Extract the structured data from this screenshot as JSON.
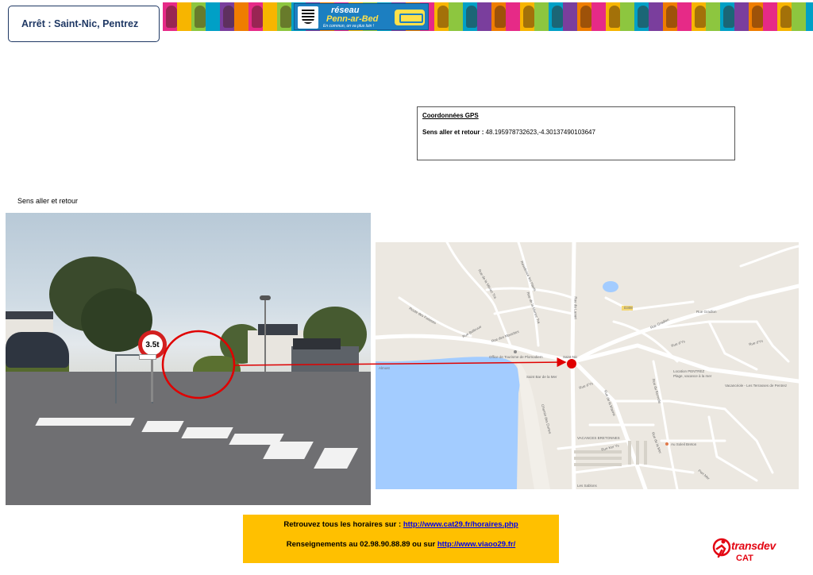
{
  "title": "Arrêt : Saint-Nic, Pentrez",
  "banner": {
    "logo_line1": "réseau",
    "logo_line2": "Penn-ar-Bed",
    "logo_tagline": "En commun, on va plus loin !"
  },
  "gps": {
    "heading": "Coordonnées GPS",
    "label": "Sens aller et retour :",
    "value": "48.195978732623,-4.30137490103647"
  },
  "photo": {
    "caption": "Sens aller et retour",
    "sign_text": "3.5t"
  },
  "map": {
    "labels": {
      "rue_lehou": "Rue de la Ménez Tra",
      "residence": "Résidence les Hauts",
      "rue_laoury": "Rue du Laouri",
      "route_falaises": "Route des Falaises",
      "rue_bellevue": "Rue Bellevue",
      "rue_mouettes": "Rue des Mouettes",
      "rue_menez": "Rue de la Menez Tra",
      "rue_gradlon": "Rue Gradlon",
      "d308": "D308",
      "rue_gradlon2": "Rue Gradlon",
      "rue_dys": "Rue d'Ys",
      "rue_dys2": "Rue d'Ys",
      "office": "Office de Tourisme de Plomodiern",
      "saint_bar": "Saint Bar de la Mer",
      "rue_dys3": "Rue d'Ys",
      "location": "Location PENTREZ",
      "plage": "Plage, vacance à la mer",
      "vacances_lili": "Vacancéole - Les Terrasses de Pentrez",
      "chemin_dunes": "Chemin des Dunes",
      "vacances_bretonnes": "VACANCES BRETONNES",
      "au_soleil": "Au Soleil Breton",
      "rue_kervelle": "Rue du Kervelle",
      "rue_kerys": "Rue Ker Ys",
      "rue_mer": "Rue de la Mer",
      "rue_marine": "Rue de la Marine",
      "port_mer": "Port Mer",
      "les_sablons": "Les Sablons",
      "almost": "Almost",
      "saint_nic_stop": "Saint-Nic"
    },
    "colors": {
      "land": "#ece8e1",
      "road": "#ffffff",
      "water": "#a3ccff",
      "beach": "#f2efe9",
      "marker": "#e00000"
    }
  },
  "info": {
    "line1_prefix": "Retrouvez tous les horaires sur : ",
    "line1_link": "http://www.cat29.fr/horaires.php",
    "line2_prefix": "Renseignements au 02.98.90.88.89 ou sur ",
    "line2_link": "http://www.viaoo29.fr/"
  },
  "logo": {
    "name": "transdev",
    "sub": "CAT"
  },
  "colors": {
    "title_border": "#1f3864",
    "info_bg": "#ffc000",
    "accent_red": "#e30613"
  }
}
